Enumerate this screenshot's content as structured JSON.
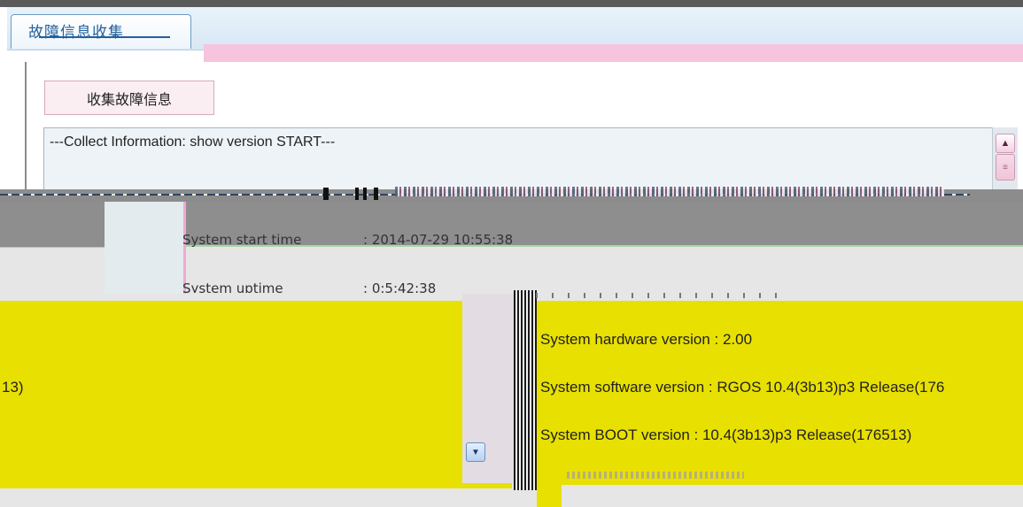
{
  "tab": {
    "label": "故障信息收集"
  },
  "toolbar": {
    "collect_button": "收集故障信息"
  },
  "output": {
    "first_line": "---Collect Information: show version  START---",
    "start_time_label": "System start time",
    "start_time_value": ": 2014-07-29 10:55:38",
    "uptime_label": "System uptime",
    "uptime_value": ": 0:5:42:38",
    "left_fragment": "13)",
    "hardware_line": "System hardware version : 2.00",
    "software_line": "System software version : RGOS 10.4(3b13)p3 Release(176",
    "boot_line": "System BOOT version     : 10.4(3b13)p3 Release(176513)"
  },
  "icons": {
    "scroll_up": "scroll-up-arrow",
    "scroll_thumb": "scroll-thumb",
    "scroll_down": "scroll-down-arrow"
  },
  "colors": {
    "tab_text": "#23609c",
    "pink_bar": "#f6c4dd",
    "glitch_yellow": "#e8e000"
  }
}
